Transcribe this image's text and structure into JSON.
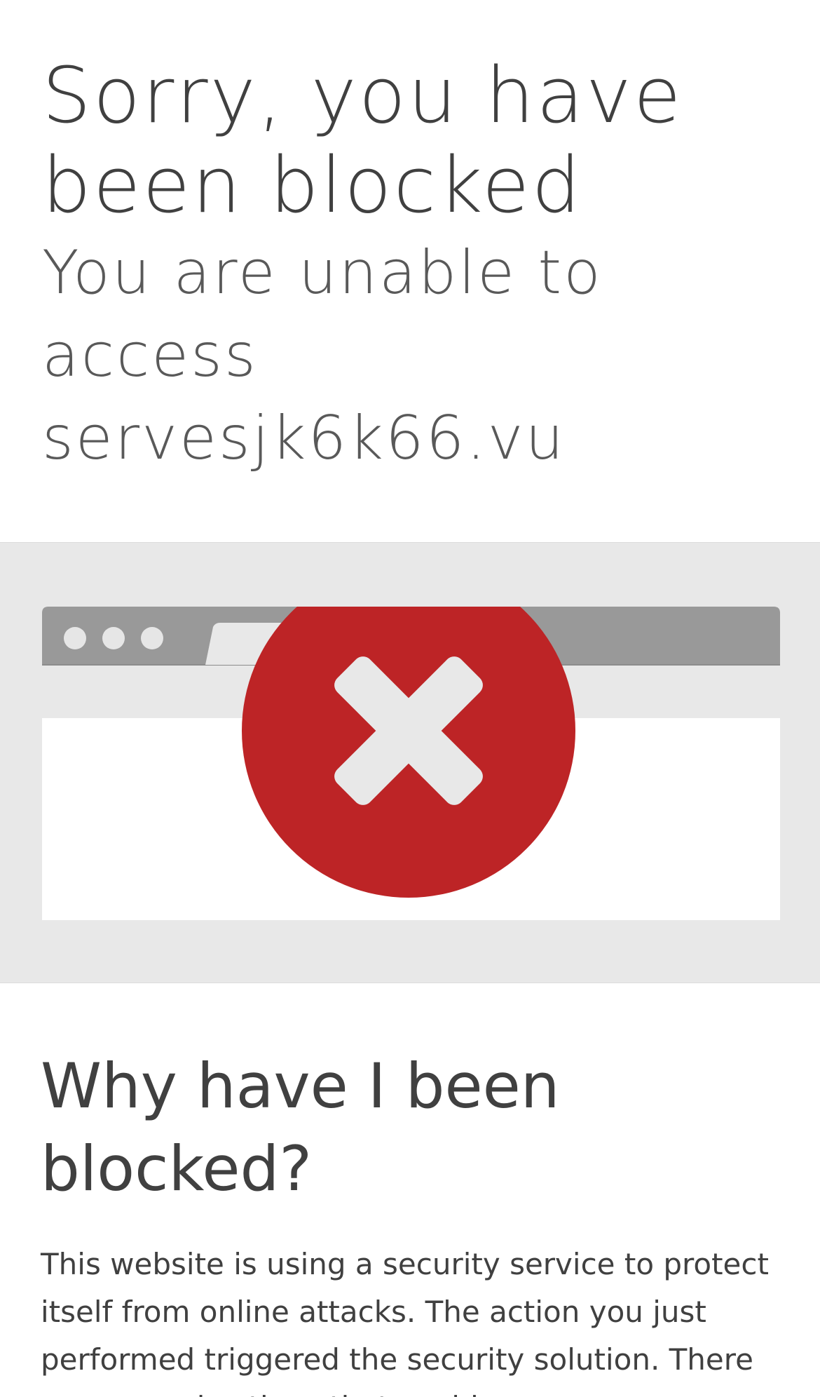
{
  "header": {
    "title": "Sorry, you have been blocked",
    "subtitle": "You are unable to access servesjk6k66.vu"
  },
  "illustration": {
    "icons": [
      "browser-window-icon",
      "error-x-icon"
    ],
    "colors": {
      "band_background": "#e8e8e8",
      "browser_chrome": "#999999",
      "browser_body": "#ffffff",
      "error_circle": "#bd2426",
      "error_cross": "#e8e8e8"
    }
  },
  "explanation": {
    "heading": "Why have I been blocked?",
    "body": "This website is using a security service to protect itself from online attacks. The action you just performed triggered the security solution. There are several actions that could"
  }
}
